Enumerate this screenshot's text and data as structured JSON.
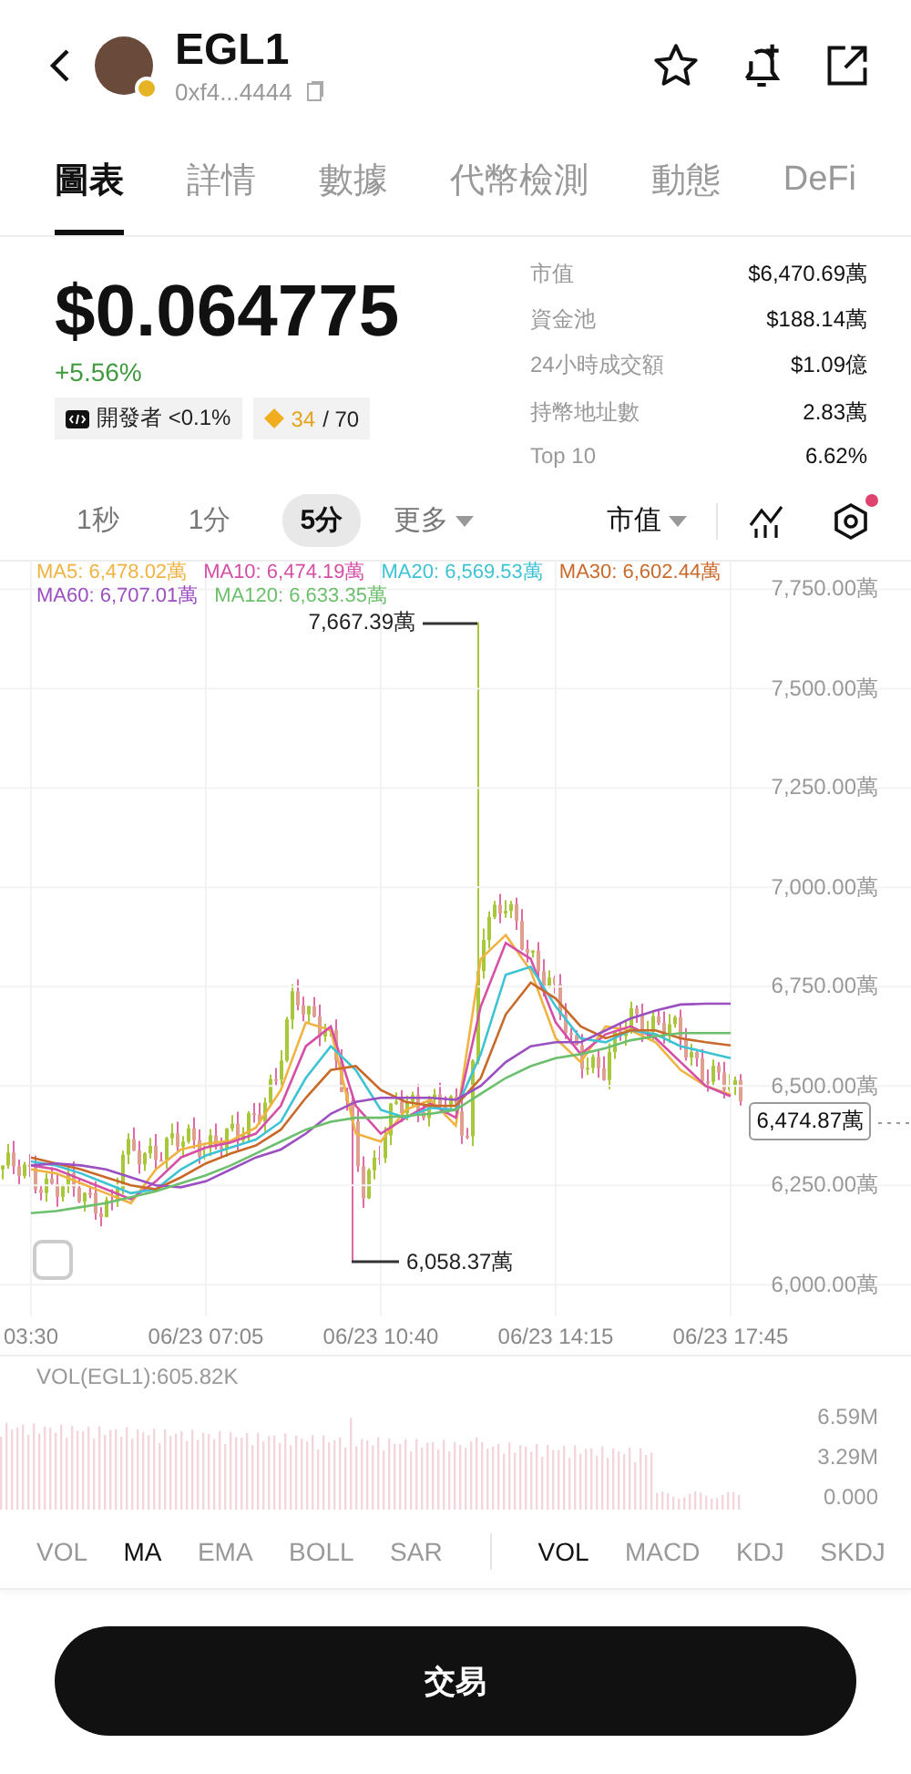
{
  "header": {
    "title": "EGL1",
    "address": "0xf4...4444",
    "verified": true
  },
  "tabs": [
    {
      "label": "圖表",
      "selected": true
    },
    {
      "label": "詳情",
      "selected": false
    },
    {
      "label": "數據",
      "selected": false
    },
    {
      "label": "代幣檢測",
      "selected": false
    },
    {
      "label": "動態",
      "selected": false
    },
    {
      "label": "DeFi",
      "selected": false
    }
  ],
  "price": "$0.064775",
  "change": "+5.56%",
  "badges": [
    {
      "kind": "dev",
      "text": "開發者 <0.1%"
    },
    {
      "kind": "score",
      "value": "34",
      "total": "/ 70"
    }
  ],
  "stats": [
    {
      "label": "市值",
      "value": "$6,470.69萬"
    },
    {
      "label": "資金池",
      "value": "$188.14萬"
    },
    {
      "label": "24小時成交額",
      "value": "$1.09億"
    },
    {
      "label": "持幣地址數",
      "value": "2.83萬"
    },
    {
      "label": "Top 10",
      "value": "6.62%"
    }
  ],
  "timeframes": [
    {
      "label": "1秒",
      "selected": false
    },
    {
      "label": "1分",
      "selected": false
    },
    {
      "label": "5分",
      "selected": true
    }
  ],
  "more": "更多",
  "metric": "市值",
  "settings_alert": true,
  "chart": {
    "high_label": "7,667.39萬",
    "low_label": "6,058.37萬",
    "last_price": "6,474.87萬",
    "chart_data": {
      "type": "line",
      "grid": true,
      "ylim": [
        5920,
        7820
      ],
      "categories": [
        "03:30",
        null,
        null,
        null,
        null,
        null,
        null,
        "06/23 07:05",
        null,
        null,
        null,
        null,
        null,
        null,
        "06/23 10:40",
        null,
        null,
        null,
        null,
        null,
        null,
        "06/23 14:15",
        null,
        null,
        null,
        null,
        null,
        null,
        "06/23 17:45"
      ],
      "yticks": [
        {
          "value": 7750,
          "label": "7,750.00萬"
        },
        {
          "value": 7500,
          "label": "7,500.00萬"
        },
        {
          "value": 7250,
          "label": "7,250.00萬"
        },
        {
          "value": 7000,
          "label": "7,000.00萬"
        },
        {
          "value": 6750,
          "label": "6,750.00萬"
        },
        {
          "value": 6500,
          "label": "6,500.00萬"
        },
        {
          "value": 6250,
          "label": "6,250.00萬"
        },
        {
          "value": 6000,
          "label": "6,000.00萬"
        }
      ],
      "series": [
        {
          "name": "MA5: 6,478.02萬",
          "color": "#f0b341",
          "values": [
            6290,
            6280,
            6255,
            6230,
            6205,
            6290,
            6340,
            6355,
            6362,
            6395,
            6490,
            6660,
            6640,
            6380,
            6360,
            6440,
            6465,
            6400,
            6820,
            6880,
            6790,
            6620,
            6560,
            6650,
            6640,
            6610,
            6540,
            6500,
            6478
          ]
        },
        {
          "name": "MA10: 6,474.19萬",
          "color": "#d54fa6",
          "values": [
            6300,
            6290,
            6265,
            6240,
            6215,
            6260,
            6320,
            6345,
            6358,
            6380,
            6450,
            6600,
            6650,
            6450,
            6380,
            6420,
            6455,
            6420,
            6700,
            6860,
            6820,
            6660,
            6580,
            6630,
            6650,
            6620,
            6560,
            6500,
            6474
          ]
        },
        {
          "name": "MA20: 6,569.53萬",
          "color": "#3ec3d4",
          "values": [
            6310,
            6300,
            6280,
            6255,
            6230,
            6240,
            6290,
            6325,
            6345,
            6365,
            6410,
            6520,
            6600,
            6540,
            6440,
            6420,
            6445,
            6440,
            6580,
            6780,
            6800,
            6700,
            6620,
            6610,
            6640,
            6630,
            6600,
            6585,
            6570
          ]
        },
        {
          "name": "MA30: 6,602.44萬",
          "color": "#c9692a",
          "values": [
            6320,
            6305,
            6290,
            6270,
            6250,
            6240,
            6270,
            6305,
            6330,
            6350,
            6390,
            6470,
            6540,
            6550,
            6490,
            6460,
            6450,
            6450,
            6520,
            6680,
            6760,
            6720,
            6650,
            6620,
            6640,
            6640,
            6620,
            6610,
            6602
          ]
        },
        {
          "name": "MA60: 6,707.01萬",
          "color": "#9b4fc0",
          "values": [
            6300,
            6305,
            6300,
            6290,
            6270,
            6250,
            6245,
            6260,
            6290,
            6320,
            6340,
            6380,
            6430,
            6460,
            6470,
            6470,
            6470,
            6465,
            6500,
            6560,
            6600,
            6610,
            6610,
            6640,
            6670,
            6690,
            6705,
            6707,
            6707
          ]
        },
        {
          "name": "MA120: 6,633.35萬",
          "color": "#6cbf6c",
          "values": [
            6180,
            6185,
            6195,
            6205,
            6220,
            6235,
            6255,
            6275,
            6300,
            6330,
            6360,
            6390,
            6410,
            6420,
            6420,
            6425,
            6430,
            6440,
            6480,
            6520,
            6550,
            6570,
            6580,
            6595,
            6615,
            6625,
            6633,
            6633,
            6633
          ]
        }
      ]
    }
  },
  "volume": {
    "title": "VOL(EGL1):605.82K",
    "ticks": [
      "6.59M",
      "3.29M",
      "0.000"
    ]
  },
  "indicators": {
    "main": [
      {
        "label": "VOL",
        "selected": false
      },
      {
        "label": "MA",
        "selected": true
      },
      {
        "label": "EMA",
        "selected": false
      },
      {
        "label": "BOLL",
        "selected": false
      },
      {
        "label": "SAR",
        "selected": false
      }
    ],
    "sub": [
      {
        "label": "VOL",
        "selected": true
      },
      {
        "label": "MACD",
        "selected": false
      },
      {
        "label": "KDJ",
        "selected": false
      },
      {
        "label": "SKDJ",
        "selected": false
      }
    ]
  },
  "trade_button": "交易"
}
